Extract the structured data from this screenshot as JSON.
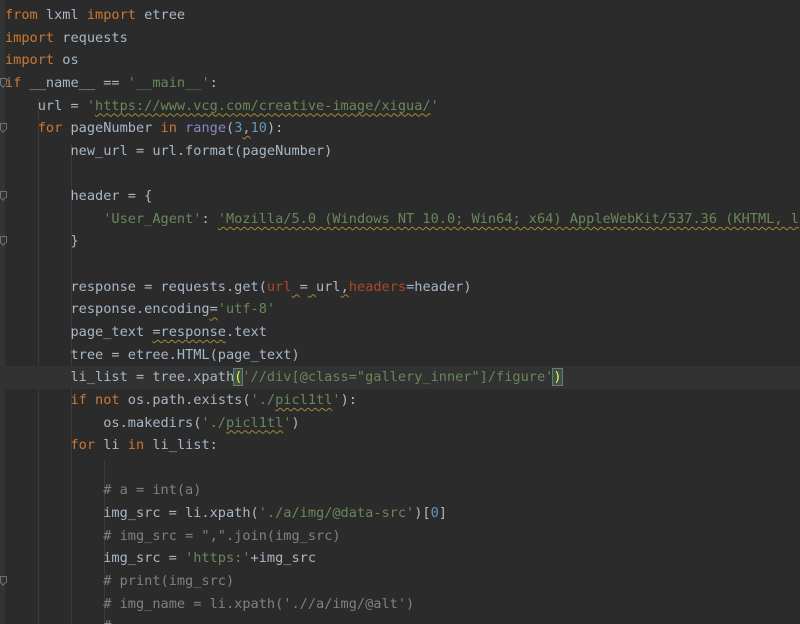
{
  "colors": {
    "background": "#2b2b2b",
    "keyword": "#cc7832",
    "string": "#6a8759",
    "number": "#6897bb",
    "comment": "#808080",
    "builtin": "#8888c6",
    "parameter": "#aa4926",
    "text": "#a9b7c6"
  },
  "lines": [
    {
      "fold": false,
      "current": false,
      "tokens": [
        {
          "t": "from",
          "c": "kw"
        },
        {
          "t": " lxml "
        },
        {
          "t": "import",
          "c": "kw"
        },
        {
          "t": " etree"
        }
      ]
    },
    {
      "fold": false,
      "current": false,
      "tokens": [
        {
          "t": "import",
          "c": "kw"
        },
        {
          "t": " requests"
        }
      ]
    },
    {
      "fold": false,
      "current": false,
      "tokens": [
        {
          "t": "import",
          "c": "kw"
        },
        {
          "t": " os"
        }
      ]
    },
    {
      "fold": true,
      "current": false,
      "tokens": [
        {
          "t": "if",
          "c": "kw"
        },
        {
          "t": " __name__ == "
        },
        {
          "t": "'__main__'",
          "c": "str"
        },
        {
          "t": ":"
        }
      ]
    },
    {
      "fold": false,
      "current": false,
      "tokens": [
        {
          "t": "    url = "
        },
        {
          "t": "'",
          "c": "str"
        },
        {
          "t": "https://www.vcg.com/creative-image/xigua/",
          "c": "str squig"
        },
        {
          "t": "'",
          "c": "str"
        }
      ]
    },
    {
      "fold": true,
      "current": false,
      "tokens": [
        {
          "t": "    "
        },
        {
          "t": "for",
          "c": "kw"
        },
        {
          "t": " pageNumber "
        },
        {
          "t": "in",
          "c": "kw"
        },
        {
          "t": " "
        },
        {
          "t": "range",
          "c": "builtin"
        },
        {
          "t": "("
        },
        {
          "t": "3",
          "c": "num"
        },
        {
          "t": ",",
          "c": "squig"
        },
        {
          "t": "10",
          "c": "num"
        },
        {
          "t": "):"
        }
      ]
    },
    {
      "fold": false,
      "current": false,
      "tokens": [
        {
          "t": "        new_url = url.format(pageNumber)"
        }
      ]
    },
    {
      "fold": false,
      "current": false,
      "tokens": [
        {
          "t": ""
        }
      ]
    },
    {
      "fold": true,
      "current": false,
      "tokens": [
        {
          "t": "        header = {"
        }
      ]
    },
    {
      "fold": false,
      "current": false,
      "tokens": [
        {
          "t": "            "
        },
        {
          "t": "'User_Agent'",
          "c": "str"
        },
        {
          "t": ": "
        },
        {
          "t": "'Mozilla/5.0 (Windows NT 10.0; Win64; x64) AppleWebKit/537.36 (KHTML, l",
          "c": "str squig"
        }
      ]
    },
    {
      "fold": true,
      "current": false,
      "tokens": [
        {
          "t": "        }"
        }
      ]
    },
    {
      "fold": false,
      "current": false,
      "tokens": [
        {
          "t": ""
        }
      ]
    },
    {
      "fold": false,
      "current": false,
      "tokens": [
        {
          "t": "        response = requests.get("
        },
        {
          "t": "url",
          "c": "param"
        },
        {
          "t": " ",
          "c": "squig"
        },
        {
          "t": "="
        },
        {
          "t": " ",
          "c": "squig"
        },
        {
          "t": "url"
        },
        {
          "t": ",",
          "c": "squig"
        },
        {
          "t": "headers",
          "c": "param"
        },
        {
          "t": "=header)"
        }
      ]
    },
    {
      "fold": false,
      "current": false,
      "tokens": [
        {
          "t": "        response.encoding"
        },
        {
          "t": "=",
          "c": "squig"
        },
        {
          "t": "'utf-8'",
          "c": "str"
        }
      ]
    },
    {
      "fold": false,
      "current": false,
      "tokens": [
        {
          "t": "        page_text "
        },
        {
          "t": "=response",
          "c": "squig"
        },
        {
          "t": ".text"
        }
      ]
    },
    {
      "fold": false,
      "current": false,
      "tokens": [
        {
          "t": "        tree = etree.HTML(page_text)"
        }
      ]
    },
    {
      "fold": false,
      "current": true,
      "tokens": [
        {
          "t": "        li_list = tree.xpath"
        },
        {
          "t": "(",
          "c": "bracket-match"
        },
        {
          "t": "'//div[@class=\"gallery_inner\"]/figure'",
          "c": "str"
        },
        {
          "t": ")",
          "c": "bracket-match"
        }
      ]
    },
    {
      "fold": false,
      "current": false,
      "tokens": [
        {
          "t": "        "
        },
        {
          "t": "if",
          "c": "kw"
        },
        {
          "t": " "
        },
        {
          "t": "not",
          "c": "kw"
        },
        {
          "t": " os.path.exists("
        },
        {
          "t": "'./",
          "c": "str"
        },
        {
          "t": "picl1tl",
          "c": "str squig"
        },
        {
          "t": "'",
          "c": "str"
        },
        {
          "t": "):"
        }
      ]
    },
    {
      "fold": false,
      "current": false,
      "tokens": [
        {
          "t": "            os.makedirs("
        },
        {
          "t": "'./",
          "c": "str"
        },
        {
          "t": "picl1tl",
          "c": "str squig"
        },
        {
          "t": "'",
          "c": "str"
        },
        {
          "t": ")"
        }
      ]
    },
    {
      "fold": false,
      "current": false,
      "tokens": [
        {
          "t": "        "
        },
        {
          "t": "for",
          "c": "kw"
        },
        {
          "t": " li "
        },
        {
          "t": "in",
          "c": "kw"
        },
        {
          "t": " li_list:"
        }
      ]
    },
    {
      "fold": false,
      "current": false,
      "tokens": [
        {
          "t": ""
        }
      ]
    },
    {
      "fold": false,
      "current": false,
      "tokens": [
        {
          "t": "            "
        },
        {
          "t": "# a = int(a)",
          "c": "cmt"
        }
      ]
    },
    {
      "fold": false,
      "current": false,
      "tokens": [
        {
          "t": "            img_src = li.xpath("
        },
        {
          "t": "'./a/img/@data-src'",
          "c": "str"
        },
        {
          "t": ")["
        },
        {
          "t": "0",
          "c": "num"
        },
        {
          "t": "]"
        }
      ]
    },
    {
      "fold": false,
      "current": false,
      "tokens": [
        {
          "t": "            "
        },
        {
          "t": "# img_src = \",\".join(img_src)",
          "c": "cmt"
        }
      ]
    },
    {
      "fold": false,
      "current": false,
      "tokens": [
        {
          "t": "            img_src = "
        },
        {
          "t": "'https:'",
          "c": "str"
        },
        {
          "t": "+img_src"
        }
      ]
    },
    {
      "fold": true,
      "current": false,
      "tokens": [
        {
          "t": "            "
        },
        {
          "t": "# print(img_src)",
          "c": "cmt"
        }
      ]
    },
    {
      "fold": false,
      "current": false,
      "tokens": [
        {
          "t": "            "
        },
        {
          "t": "# img_name = li.xpath('.//a/img/@alt')",
          "c": "cmt"
        }
      ]
    },
    {
      "fold": false,
      "current": false,
      "tokens": [
        {
          "t": "            "
        },
        {
          "t": "# ... ",
          "c": "cmt"
        }
      ]
    }
  ]
}
